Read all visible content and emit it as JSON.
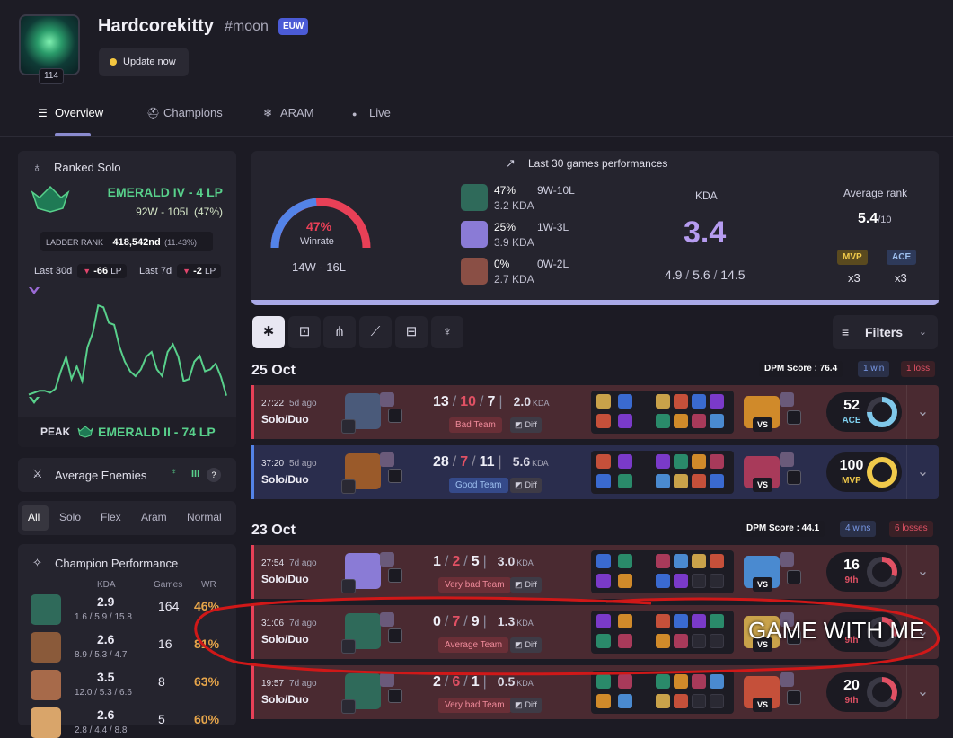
{
  "profile": {
    "name": "Hardcorekitty",
    "tag": "#moon",
    "region": "EUW",
    "level": "114",
    "update_label": "Update now"
  },
  "tabs": [
    {
      "label": "Overview",
      "icon": "list-icon"
    },
    {
      "label": "Champions",
      "icon": "helmet-icon"
    },
    {
      "label": "ARAM",
      "icon": "snowflake-icon"
    },
    {
      "label": "Live",
      "icon": "dot-icon"
    }
  ],
  "ranked": {
    "title": "Ranked Solo",
    "rank": "EMERALD IV - 4 LP",
    "record": "92W - 105L (47%)",
    "ladder_label": "LADDER RANK",
    "ladder_value": "418,542nd",
    "ladder_pct": "(11.43%)",
    "last30_label": "Last 30d",
    "last30_value": "-66",
    "last7_label": "Last 7d",
    "last7_value": "-2",
    "lp_unit": "LP",
    "peak_label": "PEAK",
    "peak_value": "EMERALD II - 74 LP",
    "lp_history": [
      0.06,
      0.08,
      0.1,
      0.1,
      0.08,
      0.12,
      0.3,
      0.45,
      0.22,
      0.35,
      0.2,
      0.55,
      0.7,
      0.98,
      0.96,
      0.8,
      0.78,
      0.55,
      0.4,
      0.3,
      0.25,
      0.32,
      0.45,
      0.5,
      0.32,
      0.25,
      0.5,
      0.58,
      0.45,
      0.2,
      0.22,
      0.4,
      0.46,
      0.3,
      0.32,
      0.38,
      0.24,
      0.05
    ]
  },
  "avg_enemies": {
    "title": "Average Enemies",
    "tier": "III",
    "help": "?"
  },
  "queue_tabs": [
    "All",
    "Solo",
    "Flex",
    "Aram",
    "Normal"
  ],
  "champ_perf": {
    "title": "Champion Performance",
    "headers": {
      "kda": "KDA",
      "games": "Games",
      "wr": "WR"
    },
    "rows": [
      {
        "kda": "2.9",
        "detail": "1.6 / 5.9 / 15.8",
        "games": "164",
        "wr": "46%",
        "color": "#2f6a5a"
      },
      {
        "kda": "2.6",
        "detail": "8.9 / 5.3 / 4.7",
        "games": "16",
        "wr": "81%",
        "color": "#8a5a3a"
      },
      {
        "kda": "3.5",
        "detail": "12.0 / 5.3 / 6.6",
        "games": "8",
        "wr": "63%",
        "color": "#a76a4a"
      },
      {
        "kda": "2.6",
        "detail": "2.8 / 4.4 / 8.8",
        "games": "5",
        "wr": "60%",
        "color": "#d9a56a"
      }
    ]
  },
  "performance": {
    "title": "Last 30 games performances",
    "winrate": "47%",
    "winrate_value": 0.47,
    "winrate_label": "Winrate",
    "record": "14W - 16L",
    "champs": [
      {
        "pct": "47%",
        "record": "9W-10L",
        "kda": "3.2 KDA",
        "color": "#2f6a5a"
      },
      {
        "pct": "25%",
        "record": "1W-3L",
        "kda": "3.9 KDA",
        "color": "#8a7bd6"
      },
      {
        "pct": "0%",
        "record": "0W-2L",
        "kda": "2.7 KDA",
        "color": "#8a4f45"
      }
    ],
    "kda_label": "KDA",
    "kda_value": "3.4",
    "kda_k": "4.9",
    "kda_d": "5.6",
    "kda_a": "14.5",
    "avg_rank_label": "Average rank",
    "avg_rank": "5.4",
    "avg_rank_of": "/10",
    "mvp_label": "MVP",
    "mvp_count": "x3",
    "ace_label": "ACE",
    "ace_count": "x3"
  },
  "filters_label": "Filters",
  "days": [
    {
      "date": "25 Oct",
      "dpm": "DPM Score : 76.4",
      "wins": "1 win",
      "losses": "1 loss"
    },
    {
      "date": "23 Oct",
      "dpm": "DPM Score : 44.1",
      "wins": "4 wins",
      "losses": "6 losses"
    }
  ],
  "games": [
    {
      "result": "loss",
      "time": "27:22",
      "ago": "5d ago",
      "queue": "Solo/Duo",
      "k": "13",
      "d": "10",
      "a": "7",
      "ratio": "2.0",
      "team": "Bad Team",
      "diff": "Diff",
      "score": "52",
      "badge": "ACE",
      "badge_color": "#7fd0ef",
      "ring_color": "#7fc8ea",
      "ring": 0.75,
      "champ": "#4a5a7a"
    },
    {
      "result": "win",
      "time": "37:20",
      "ago": "5d ago",
      "queue": "Solo/Duo",
      "k": "28",
      "d": "7",
      "a": "11",
      "ratio": "5.6",
      "team": "Good Team",
      "diff": "Diff",
      "score": "100",
      "badge": "MVP",
      "badge_color": "#f0c94a",
      "ring_color": "#f0c94a",
      "ring": 1.0,
      "champ": "#9a5a2a"
    },
    {
      "result": "loss",
      "time": "27:54",
      "ago": "7d ago",
      "queue": "Solo/Duo",
      "k": "1",
      "d": "2",
      "a": "5",
      "ratio": "3.0",
      "team": "Very bad Team",
      "diff": "Diff",
      "score": "16",
      "badge": "9th",
      "badge_color": "#e05164",
      "ring_color": "#e05164",
      "ring": 0.3,
      "champ": "#8a7bd6"
    },
    {
      "result": "loss",
      "time": "31:06",
      "ago": "7d ago",
      "queue": "Solo/Duo",
      "k": "0",
      "d": "7",
      "a": "9",
      "ratio": "1.3",
      "team": "Average Team",
      "diff": "Diff",
      "score": "",
      "badge": "9th",
      "badge_color": "#e05164",
      "ring_color": "#e05164",
      "ring": 0.3,
      "champ": "#2f6a5a"
    },
    {
      "result": "loss",
      "time": "19:57",
      "ago": "7d ago",
      "queue": "Solo/Duo",
      "k": "2",
      "d": "6",
      "a": "1",
      "ratio": "0.5",
      "team": "Very bad Team",
      "diff": "Diff",
      "score": "20",
      "badge": "9th",
      "badge_color": "#e05164",
      "ring_color": "#e05164",
      "ring": 0.35,
      "champ": "#2f6a5a"
    }
  ],
  "overlay_text": "GAME WITH ME",
  "colors": {
    "accent": "#8a8bcf",
    "win": "#5383e8",
    "loss": "#e84057",
    "emerald": "#58d08b"
  }
}
